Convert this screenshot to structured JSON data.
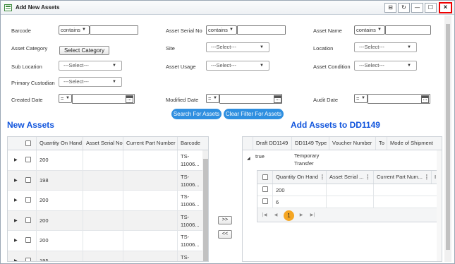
{
  "window": {
    "title": "Add New Assets",
    "controls": {
      "pin": "⊟",
      "refresh": "↻",
      "minimize": "—",
      "maximize": "☐",
      "close": "x"
    }
  },
  "filters": {
    "barcode": {
      "label": "Barcode",
      "operator": "contains"
    },
    "asset_serial_no": {
      "label": "Asset Serial No",
      "operator": "contains"
    },
    "asset_name": {
      "label": "Asset Name",
      "operator": "contains"
    },
    "asset_category": {
      "label": "Asset Category",
      "button": "Select Category"
    },
    "site": {
      "label": "Site",
      "value": "---Select---"
    },
    "location": {
      "label": "Location",
      "value": "---Select---"
    },
    "sub_location": {
      "label": "Sub Location",
      "value": "---Select---"
    },
    "asset_usage": {
      "label": "Asset Usage",
      "value": "---Select---"
    },
    "asset_condition": {
      "label": "Asset Condition",
      "value": "---Select---"
    },
    "primary_custodian": {
      "label": "Primary Custodian",
      "value": "---Select---"
    },
    "created_date": {
      "label": "Created Date",
      "operator": "="
    },
    "modified_date": {
      "label": "Modified Date",
      "operator": "="
    },
    "audit_date": {
      "label": "Audit Date",
      "operator": "="
    },
    "search_button": "Search For Assets",
    "clear_button": "Clear Filter For Assets"
  },
  "new_assets": {
    "title": "New Assets",
    "columns": [
      "Quantity On Hand",
      "Asset Serial No",
      "Current Part Number",
      "Barcode"
    ],
    "rows": [
      {
        "qty": "200",
        "barcode": [
          "TS-",
          "11006..."
        ]
      },
      {
        "qty": "198",
        "barcode": [
          "TS-",
          "11006..."
        ]
      },
      {
        "qty": "200",
        "barcode": [
          "TS-",
          "11006..."
        ]
      },
      {
        "qty": "200",
        "barcode": [
          "TS-",
          "11006..."
        ]
      },
      {
        "qty": "200",
        "barcode": [
          "TS-",
          "11006..."
        ]
      },
      {
        "qty": "195",
        "barcode": [
          "TS-",
          ""
        ]
      }
    ]
  },
  "transfer": {
    "add": ">>",
    "remove": "<<"
  },
  "dd1149": {
    "title": "Add Assets to DD1149",
    "columns": [
      "Draft DD1149",
      "DD1149 Type",
      "Voucher Number",
      "To",
      "Mode of Shipment"
    ],
    "row": {
      "draft": "true",
      "type": [
        "Temporary",
        "Transfer"
      ]
    },
    "sub_columns": [
      "Quantity On Hand",
      "Asset Serial ...",
      "Current Part Num...",
      "I"
    ],
    "sub_rows": [
      {
        "qty": "200"
      },
      {
        "qty": "6"
      }
    ],
    "pager": {
      "first": "|◀",
      "prev": "◀",
      "page": "1",
      "next": "▶",
      "last": "▶|"
    }
  }
}
